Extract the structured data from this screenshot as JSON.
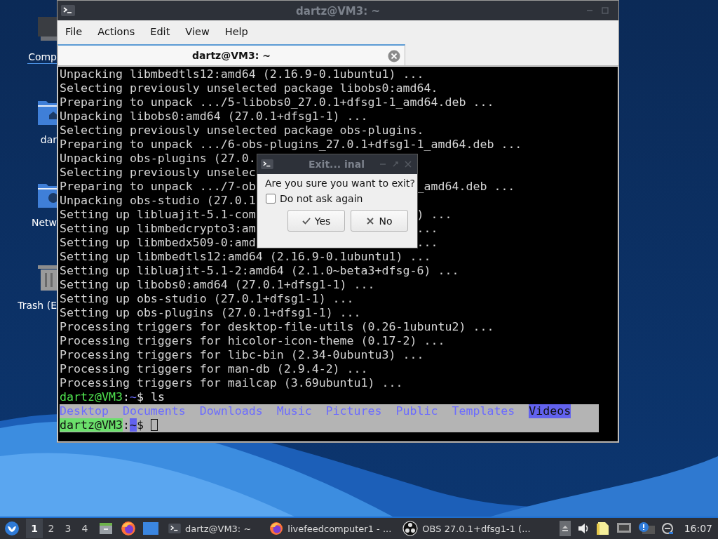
{
  "desktop": {
    "icons": [
      {
        "kind": "computer",
        "label": "Comp",
        "selected": true
      },
      {
        "kind": "home",
        "label": "dar",
        "selected": false
      },
      {
        "kind": "network",
        "label": "Netw",
        "selected": false
      },
      {
        "kind": "trash",
        "label": "Trash (E",
        "selected": false
      }
    ]
  },
  "terminal_window": {
    "title": "dartz@VM3: ~",
    "menu": [
      "File",
      "Actions",
      "Edit",
      "View",
      "Help"
    ],
    "tabs": [
      {
        "label": "dartz@VM3: ~",
        "selected": true
      }
    ],
    "lines": [
      {
        "kind": "output",
        "text": "Unpacking libmbedtls12:amd64 (2.16.9-0.1ubuntu1) ..."
      },
      {
        "kind": "output",
        "text": "Selecting previously unselected package libobs0:amd64."
      },
      {
        "kind": "output",
        "text": "Preparing to unpack .../5-libobs0_27.0.1+dfsg1-1_amd64.deb ..."
      },
      {
        "kind": "output",
        "text": "Unpacking libobs0:amd64 (27.0.1+dfsg1-1) ..."
      },
      {
        "kind": "output",
        "text": "Selecting previously unselected package obs-plugins."
      },
      {
        "kind": "output",
        "text": "Preparing to unpack .../6-obs-plugins_27.0.1+dfsg1-1_amd64.deb ..."
      },
      {
        "kind": "output",
        "text": "Unpacking obs-plugins (27.0."
      },
      {
        "kind": "output",
        "text": "Selecting previously unselec"
      },
      {
        "kind": "output",
        "text": "Preparing to unpack .../7-ob",
        "after": "_amd64.deb ..."
      },
      {
        "kind": "output",
        "text": "Unpacking obs-studio (27.0.1"
      },
      {
        "kind": "output",
        "text": "Setting up libluajit-5.1-com",
        "after": ") ..."
      },
      {
        "kind": "output",
        "text": "Setting up libmbedcrypto3:am",
        "after": "..."
      },
      {
        "kind": "output",
        "text": "Setting up libmbedx509-0:amd",
        "after": "..."
      },
      {
        "kind": "output",
        "text": "Setting up libmbedtls12:amd64 (2.16.9-0.1ubuntu1) ..."
      },
      {
        "kind": "output",
        "text": "Setting up libluajit-5.1-2:amd64 (2.1.0~beta3+dfsg-6) ..."
      },
      {
        "kind": "output",
        "text": "Setting up libobs0:amd64 (27.0.1+dfsg1-1) ..."
      },
      {
        "kind": "output",
        "text": "Setting up obs-studio (27.0.1+dfsg1-1) ..."
      },
      {
        "kind": "output",
        "text": "Setting up obs-plugins (27.0.1+dfsg1-1) ..."
      },
      {
        "kind": "output",
        "text": "Processing triggers for desktop-file-utils (0.26-1ubuntu2) ..."
      },
      {
        "kind": "output",
        "text": "Processing triggers for hicolor-icon-theme (0.17-2) ..."
      },
      {
        "kind": "output",
        "text": "Processing triggers for libc-bin (2.34-0ubuntu3) ..."
      },
      {
        "kind": "output",
        "text": "Processing triggers for man-db (2.9.4-2) ..."
      },
      {
        "kind": "output",
        "text": "Processing triggers for mailcap (3.69ubuntu1) ..."
      },
      {
        "kind": "prompt",
        "highlighted": false,
        "cursor": false,
        "segments": [
          {
            "kind": "user",
            "text": "dartz@VM3"
          },
          {
            "kind": "plain",
            "text": ":"
          },
          {
            "kind": "path",
            "text": "~"
          },
          {
            "kind": "plain",
            "text": "$ ls"
          }
        ]
      },
      {
        "kind": "listing",
        "highlighted": true,
        "entries": [
          {
            "name": "Desktop",
            "selected": false
          },
          {
            "name": "Documents",
            "selected": false
          },
          {
            "name": "Downloads",
            "selected": false
          },
          {
            "name": "Music",
            "selected": false
          },
          {
            "name": "Pictures",
            "selected": false
          },
          {
            "name": "Public",
            "selected": false
          },
          {
            "name": "Templates",
            "selected": false
          },
          {
            "name": "Videos",
            "selected": true
          }
        ]
      },
      {
        "kind": "prompt",
        "highlighted": true,
        "cursor": true,
        "segments": [
          {
            "kind": "user",
            "text": "dartz@VM3"
          },
          {
            "kind": "plain",
            "text": ":"
          },
          {
            "kind": "path",
            "text": "~"
          },
          {
            "kind": "plain",
            "text": "$"
          }
        ]
      }
    ]
  },
  "exit_dialog": {
    "title": "Exit... inal",
    "message": "Are you sure you want to exit?",
    "checkbox": {
      "label": "Do not ask again",
      "checked": false
    },
    "buttons": [
      {
        "kind": "yes",
        "label": "Yes"
      },
      {
        "kind": "no",
        "label": "No"
      }
    ]
  },
  "taskbar": {
    "workspaces": [
      {
        "label": "1",
        "selected": true
      },
      {
        "label": "2",
        "selected": false
      },
      {
        "label": "3",
        "selected": false
      },
      {
        "label": "4",
        "selected": false
      }
    ],
    "tasks": [
      {
        "kind": "terminal",
        "label": "dartz@VM3: ~"
      },
      {
        "kind": "firefox",
        "label": "livefeedcomputer1 - ..."
      },
      {
        "kind": "obs",
        "label": "OBS 27.0.1+dfsg1-1 (..."
      }
    ],
    "clock": "16:07"
  }
}
